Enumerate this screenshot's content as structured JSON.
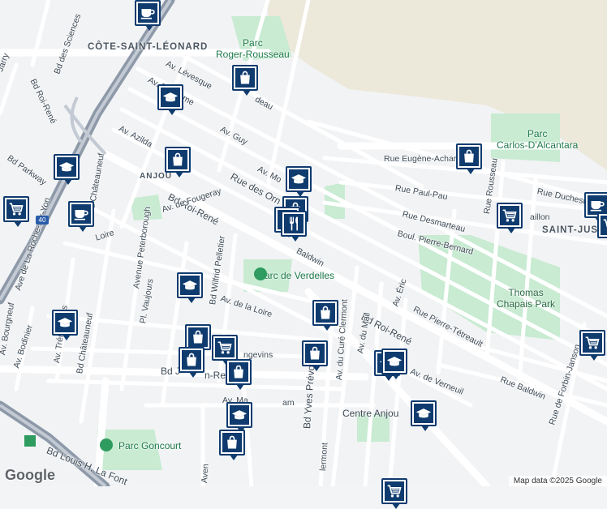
{
  "map": {
    "areas": {
      "cote_saint_leonard": "CÔTE-SAINT-LÉONARD",
      "anjou": "ANJOU",
      "saint_justin": "SAINT-JUST"
    },
    "parks": {
      "roger_rousseau": "Parc\nRoger-Rousseau",
      "carlos": "Parc\nCarlos-D'Alcantara",
      "verdelles": "Parc de Verdelles",
      "thomas_chapais": "Thomas\nChapais Park",
      "goncourt": "Parc Goncourt",
      "centre_anjou": "Centre Anjou"
    },
    "streets": {
      "jarry": "Jarry",
      "sciences": "Bd des Sciences",
      "levesque": "Av. Lévesque",
      "rheaume": "Av. Rhéaume",
      "deau": "deau",
      "azilda": "Av. Azilda",
      "guy": "Av. Guy",
      "roi_rene_nw": "Bd Roi-René",
      "parkway": "Bd Parkway",
      "anjou_ave": "Av. Mo",
      "orn": "Rue des Orn",
      "eugene": "Rue Eugène-Achard",
      "paul_pau": "Rue Paul-Pau",
      "duchesne": "Rue Duchesn",
      "rousseau": "Rue Rousseau",
      "desmarteau": "Rue Desmarteau",
      "taillon": "aillon",
      "pierre_bernard": "Boul. Pierre-Bernard",
      "roi_rene_mid": "Bd Roi-René",
      "chateauneuf": "Bd Châteauneuf",
      "fougeray": "Av. de Fougeray",
      "loire_w": "Loire",
      "roche_sur_yon": "Ave de La Roche-sur-Yon",
      "peterborough": "Avenue Peterborough",
      "vaujours": "Pl. Vaujours",
      "wilfrid": "Bd Wilfrid Pelletier",
      "baldwin": "Baldwin",
      "loire_e": "Av. de la Loire",
      "eric": "Av. Éric",
      "pierre_tetreault": "Rue Pierre-Tétreault",
      "roi_rene_se": "Bd Roi-René",
      "bourgneuf": "Av. Bourgneuf",
      "tremolieres": "Av. Trémolières",
      "bodinier": "Av. Bodinier",
      "chateauneuf2": "Bd Châteauneuf",
      "angevins": "ngevins",
      "bd_j": "Bd J",
      "re": "n-Re",
      "maam": "Av. Ma",
      "am": "am",
      "cure_clermont": "Av. du Curé Clermont",
      "mail": "Av. du Mail",
      "verneuil": "Av. de Verneuil",
      "yves_prevost": "Bd Yves Prévost",
      "baldwin_e": "Rue Baldwin",
      "forbin": "Rue de Forbin-Janson",
      "louis_h": "Bd Louis H. La Font",
      "clermont2": "lermont",
      "aven": "Aven",
      "route40": "40"
    },
    "markers": [
      {
        "type": "cafe",
        "icon": "coffee-icon"
      },
      {
        "type": "shopping",
        "icon": "shopping-bag-icon"
      },
      {
        "type": "school",
        "icon": "graduation-cap-icon"
      },
      {
        "type": "grocery",
        "icon": "shopping-cart-icon"
      },
      {
        "type": "restaurant",
        "icon": "fork-knife-icon"
      }
    ]
  },
  "footer": {
    "logo": "Google",
    "attribution": "Map data ©2025 Google"
  },
  "colors": {
    "park": "#c8ebd2",
    "road": "#ffffff",
    "highway": "#8d99a8",
    "marker": "#0f3b6e",
    "industrial": "#ece8da"
  }
}
